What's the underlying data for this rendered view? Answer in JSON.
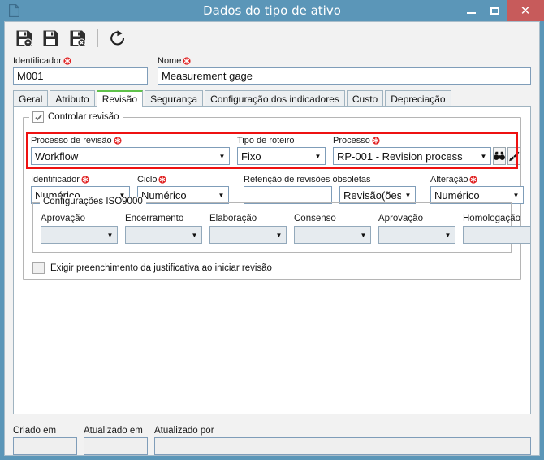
{
  "window": {
    "title": "Dados do tipo de ativo",
    "doc_icon": "document-icon",
    "minimize_label": "Minimizar",
    "maximize_label": "Maximizar",
    "close_label": "Fechar",
    "close_glyph": "✕"
  },
  "toolbar": {
    "buttons": [
      {
        "name": "save-and-new-button",
        "icon": "floppy-disk-add-icon",
        "label": "Salvar e novo"
      },
      {
        "name": "save-button",
        "icon": "floppy-disk-icon",
        "label": "Salvar"
      },
      {
        "name": "save-and-close-button",
        "icon": "floppy-disk-close-icon",
        "label": "Salvar e fechar"
      },
      {
        "name": "refresh-button",
        "icon": "refresh-icon",
        "label": "Atualizar"
      }
    ]
  },
  "header": {
    "identificador": {
      "label": "Identificador",
      "value": "M001",
      "required": true
    },
    "nome": {
      "label": "Nome",
      "value": "Measurement gage",
      "required": true
    }
  },
  "tabs": [
    {
      "label": "Geral",
      "active": false
    },
    {
      "label": "Atributo",
      "active": false
    },
    {
      "label": "Revisão",
      "active": true
    },
    {
      "label": "Segurança",
      "active": false
    },
    {
      "label": "Configuração dos indicadores",
      "active": false
    },
    {
      "label": "Custo",
      "active": false
    },
    {
      "label": "Depreciação",
      "active": false
    }
  ],
  "revision": {
    "group_label": "Controlar revisão",
    "group_checked": true,
    "highlight_color": "#ee1111",
    "processo_de_revisao": {
      "label": "Processo de revisão",
      "value": "Workflow",
      "required": true
    },
    "tipo_de_roteiro": {
      "label": "Tipo de roteiro",
      "value": "Fixo",
      "required": false
    },
    "processo": {
      "label": "Processo",
      "value": "RP-001 - Revision process",
      "required": true
    },
    "processo_search_icon": "binoculars-icon",
    "processo_clear_icon": "brush-icon",
    "identificador": {
      "label": "Identificador",
      "value": "Numérico",
      "required": true
    },
    "ciclo": {
      "label": "Ciclo",
      "value": "Numérico",
      "required": true
    },
    "retencao": {
      "label": "Retenção de revisões obsoletas",
      "value": "",
      "unit": "Revisão(ões)"
    },
    "alteracao": {
      "label": "Alteração",
      "value": "Numérico",
      "required": true
    },
    "iso": {
      "legend": "Configurações ISO9000",
      "fields": [
        {
          "label": "Aprovação",
          "value": ""
        },
        {
          "label": "Encerramento",
          "value": ""
        },
        {
          "label": "Elaboração",
          "value": ""
        },
        {
          "label": "Consenso",
          "value": ""
        },
        {
          "label": "Aprovação",
          "value": ""
        },
        {
          "label": "Homologação",
          "value": ""
        }
      ]
    },
    "justificativa": {
      "label": "Exigir preenchimento da justificativa ao iniciar revisão",
      "checked": false
    }
  },
  "footer": {
    "criado_em": {
      "label": "Criado em",
      "value": ""
    },
    "atualizado_em": {
      "label": "Atualizado em",
      "value": ""
    },
    "atualizado_por": {
      "label": "Atualizado por",
      "value": ""
    }
  }
}
